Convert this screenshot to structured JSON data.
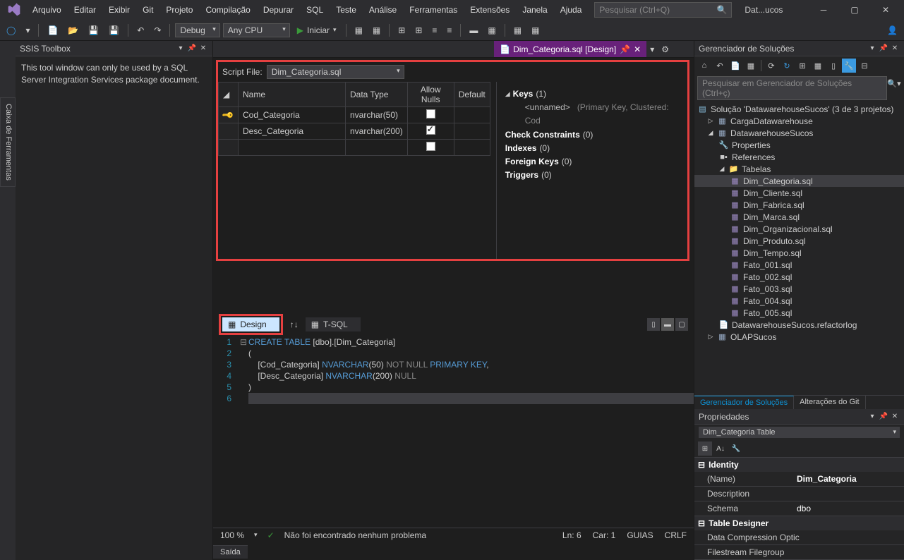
{
  "menu": [
    "Arquivo",
    "Editar",
    "Exibir",
    "Git",
    "Projeto",
    "Compilação",
    "Depurar",
    "SQL",
    "Teste",
    "Análise",
    "Ferramentas",
    "Extensões",
    "Janela",
    "Ajuda"
  ],
  "search_placeholder": "Pesquisar (Ctrl+Q)",
  "window_title": "Dat...ucos",
  "toolbar": {
    "config": "Debug",
    "platform": "Any CPU",
    "start": "Iniciar"
  },
  "left_vertical_tab": "Caixa de Ferramentas",
  "ssis": {
    "title": "SSIS Toolbox",
    "message": "This tool window can only be used by a SQL Server Integration Services package document."
  },
  "doc_tab": {
    "label": "Dim_Categoria.sql [Design]"
  },
  "designer": {
    "script_file_label": "Script File:",
    "script_file_value": "Dim_Categoria.sql",
    "columns": {
      "headers": [
        "Name",
        "Data Type",
        "Allow Nulls",
        "Default"
      ],
      "rows": [
        {
          "key": true,
          "name": "Cod_Categoria",
          "dtype": "nvarchar(50)",
          "nulls": false,
          "def": ""
        },
        {
          "key": false,
          "name": "Desc_Categoria",
          "dtype": "nvarchar(200)",
          "nulls": true,
          "def": ""
        }
      ]
    },
    "props": {
      "keys_label": "Keys",
      "keys_count": "(1)",
      "keys_item": "<unnamed>",
      "keys_desc": "(Primary Key, Clustered: Cod",
      "check_label": "Check Constraints",
      "check_count": "(0)",
      "indexes_label": "Indexes",
      "indexes_count": "(0)",
      "fk_label": "Foreign Keys",
      "fk_count": "(0)",
      "triggers_label": "Triggers",
      "triggers_count": "(0)"
    }
  },
  "bottom_tabs": {
    "design": "Design",
    "tsql": "T-SQL"
  },
  "code": {
    "lines": [
      {
        "n": "1",
        "c": "CREATE TABLE [dbo].[Dim_Categoria]"
      },
      {
        "n": "2",
        "c": "("
      },
      {
        "n": "3",
        "c": "    [Cod_Categoria] NVARCHAR(50) NOT NULL PRIMARY KEY,"
      },
      {
        "n": "4",
        "c": "    [Desc_Categoria] NVARCHAR(200) NULL"
      },
      {
        "n": "5",
        "c": ")"
      },
      {
        "n": "6",
        "c": ""
      }
    ]
  },
  "status": {
    "zoom": "100 %",
    "ok": "Não foi encontrado nenhum problema",
    "ln": "Ln: 6",
    "car": "Car: 1",
    "guias": "GUIAS",
    "crlf": "CRLF"
  },
  "output_tab": "Saída",
  "solution": {
    "title": "Gerenciador de Soluções",
    "search_placeholder": "Pesquisar em Gerenciador de Soluções (Ctrl+ç)",
    "root": "Solução 'DatawarehouseSucos' (3 de 3 projetos)",
    "projects": {
      "carga": "CargaDatawarehouse",
      "sucos": "DatawarehouseSucos",
      "props": "Properties",
      "refs": "References",
      "tabelas": "Tabelas",
      "files": [
        "Dim_Categoria.sql",
        "Dim_Cliente.sql",
        "Dim_Fabrica.sql",
        "Dim_Marca.sql",
        "Dim_Organizacional.sql",
        "Dim_Produto.sql",
        "Dim_Tempo.sql",
        "Fato_001.sql",
        "Fato_002.sql",
        "Fato_003.sql",
        "Fato_004.sql",
        "Fato_005.sql"
      ],
      "refactor": "DatawarehouseSucos.refactorlog",
      "olap": "OLAPSucos"
    },
    "tabs": {
      "sol": "Gerenciador de Soluções",
      "git": "Alterações do Git"
    }
  },
  "propgrid": {
    "title": "Propriedades",
    "combo": "Dim_Categoria  Table",
    "cat_identity": "Identity",
    "name_label": "(Name)",
    "name_val": "Dim_Categoria",
    "desc_label": "Description",
    "schema_label": "Schema",
    "schema_val": "dbo",
    "cat_td": "Table Designer",
    "dcomp": "Data Compression Optic",
    "fstream": "Filestream Filegroup"
  }
}
